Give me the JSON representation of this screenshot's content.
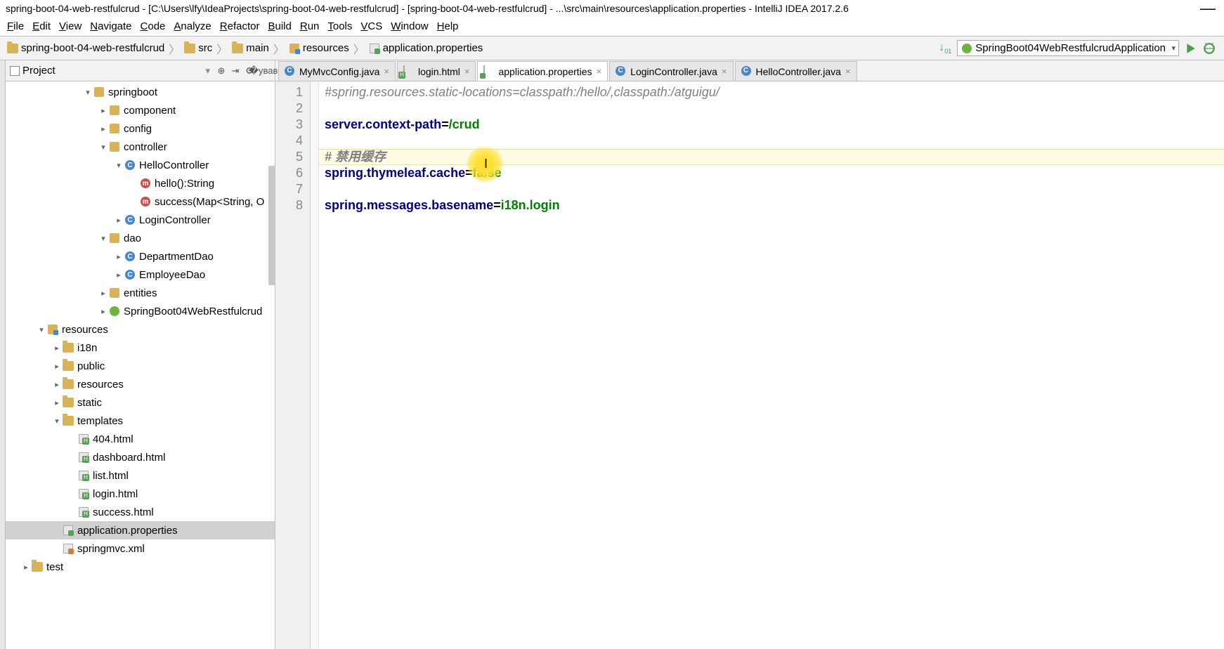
{
  "window": {
    "title": "spring-boot-04-web-restfulcrud - [C:\\Users\\lfy\\IdeaProjects\\spring-boot-04-web-restfulcrud] - [spring-boot-04-web-restfulcrud] - ...\\src\\main\\resources\\application.properties - IntelliJ IDEA 2017.2.6"
  },
  "menu": [
    "File",
    "Edit",
    "View",
    "Navigate",
    "Code",
    "Analyze",
    "Refactor",
    "Build",
    "Run",
    "Tools",
    "VCS",
    "Window",
    "Help"
  ],
  "breadcrumbs": [
    {
      "label": "spring-boot-04-web-restfulcrud",
      "icon": "folder"
    },
    {
      "label": "src",
      "icon": "folder"
    },
    {
      "label": "main",
      "icon": "folder"
    },
    {
      "label": "resources",
      "icon": "res"
    },
    {
      "label": "application.properties",
      "icon": "prop"
    }
  ],
  "runConfig": "SpringBoot04WebRestfulcrudApplication",
  "projectPanel": {
    "title": "Project"
  },
  "tree": [
    {
      "indent": 5,
      "arrow": "down",
      "icon": "pkg",
      "label": "springboot"
    },
    {
      "indent": 6,
      "arrow": "right",
      "icon": "pkg",
      "label": "component"
    },
    {
      "indent": 6,
      "arrow": "right",
      "icon": "pkg",
      "label": "config"
    },
    {
      "indent": 6,
      "arrow": "down",
      "icon": "pkg",
      "label": "controller"
    },
    {
      "indent": 7,
      "arrow": "down",
      "icon": "class",
      "label": "HelloController"
    },
    {
      "indent": 8,
      "arrow": "",
      "icon": "method",
      "label": "hello():String"
    },
    {
      "indent": 8,
      "arrow": "",
      "icon": "method",
      "label": "success(Map<String, O"
    },
    {
      "indent": 7,
      "arrow": "right",
      "icon": "class",
      "label": "LoginController"
    },
    {
      "indent": 6,
      "arrow": "down",
      "icon": "pkg",
      "label": "dao"
    },
    {
      "indent": 7,
      "arrow": "right",
      "icon": "class",
      "label": "DepartmentDao"
    },
    {
      "indent": 7,
      "arrow": "right",
      "icon": "class",
      "label": "EmployeeDao"
    },
    {
      "indent": 6,
      "arrow": "right",
      "icon": "pkg",
      "label": "entities"
    },
    {
      "indent": 6,
      "arrow": "right",
      "icon": "spring",
      "label": "SpringBoot04WebRestfulcrud"
    },
    {
      "indent": 2,
      "arrow": "down",
      "icon": "res",
      "label": "resources"
    },
    {
      "indent": 3,
      "arrow": "right",
      "icon": "folder",
      "label": "i18n"
    },
    {
      "indent": 3,
      "arrow": "right",
      "icon": "folder",
      "label": "public"
    },
    {
      "indent": 3,
      "arrow": "right",
      "icon": "folder",
      "label": "resources"
    },
    {
      "indent": 3,
      "arrow": "right",
      "icon": "folder",
      "label": "static"
    },
    {
      "indent": 3,
      "arrow": "down",
      "icon": "folder",
      "label": "templates"
    },
    {
      "indent": 4,
      "arrow": "",
      "icon": "html",
      "label": "404.html"
    },
    {
      "indent": 4,
      "arrow": "",
      "icon": "html",
      "label": "dashboard.html"
    },
    {
      "indent": 4,
      "arrow": "",
      "icon": "html",
      "label": "list.html"
    },
    {
      "indent": 4,
      "arrow": "",
      "icon": "html",
      "label": "login.html"
    },
    {
      "indent": 4,
      "arrow": "",
      "icon": "html",
      "label": "success.html"
    },
    {
      "indent": 3,
      "arrow": "",
      "icon": "prop",
      "label": "application.properties",
      "selected": true
    },
    {
      "indent": 3,
      "arrow": "",
      "icon": "xml",
      "label": "springmvc.xml"
    },
    {
      "indent": 1,
      "arrow": "right",
      "icon": "folder",
      "label": "test"
    }
  ],
  "tabs": [
    {
      "label": "MyMvcConfig.java",
      "icon": "class",
      "active": false
    },
    {
      "label": "login.html",
      "icon": "html",
      "active": false
    },
    {
      "label": "application.properties",
      "icon": "prop",
      "active": true
    },
    {
      "label": "LoginController.java",
      "icon": "class",
      "active": false
    },
    {
      "label": "HelloController.java",
      "icon": "class",
      "active": false
    }
  ],
  "editor": {
    "lines": [
      {
        "n": 1,
        "t": "comment",
        "text": "#spring.resources.static-locations=classpath:/hello/,classpath:/atguigu/"
      },
      {
        "n": 2,
        "t": "blank",
        "text": ""
      },
      {
        "n": 3,
        "t": "kv",
        "key": "server.context-path",
        "val": "/crud"
      },
      {
        "n": 4,
        "t": "blank",
        "text": ""
      },
      {
        "n": 5,
        "t": "hash",
        "text": "# 禁用缓存"
      },
      {
        "n": 6,
        "t": "kv",
        "key": "spring.thymeleaf.cache",
        "val": "false"
      },
      {
        "n": 7,
        "t": "blank",
        "text": ""
      },
      {
        "n": 8,
        "t": "kv",
        "key": "spring.messages.basename",
        "val": "i18n.login"
      }
    ]
  }
}
